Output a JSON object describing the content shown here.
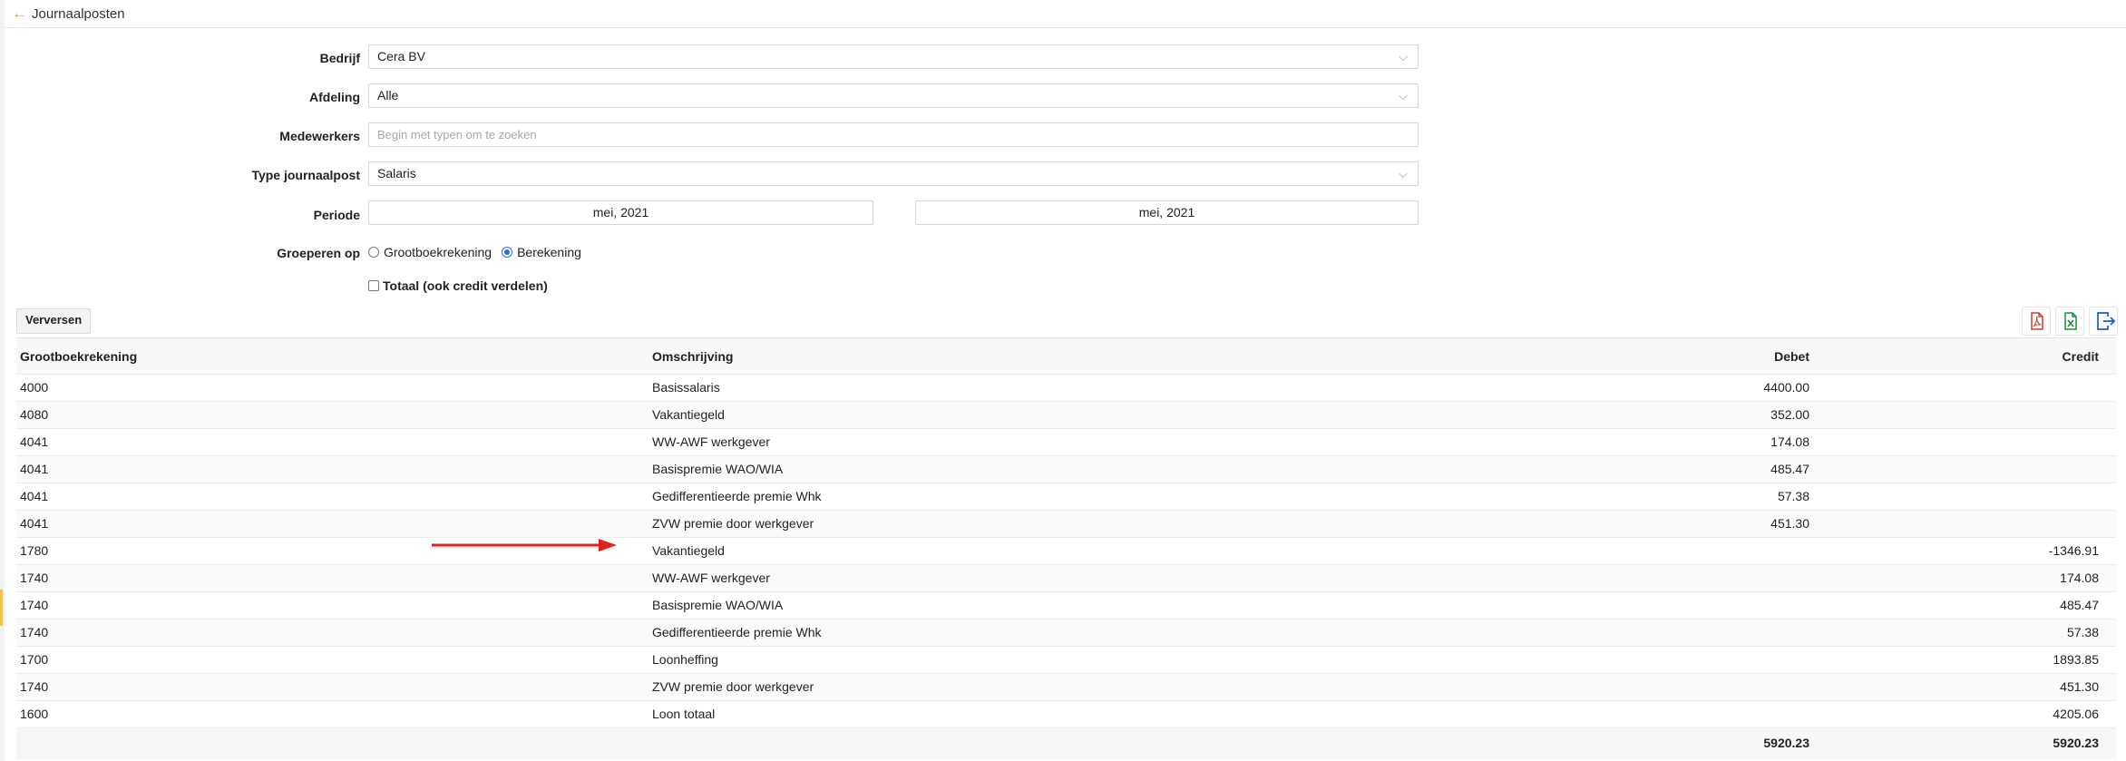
{
  "header": {
    "title": "Journaalposten"
  },
  "form": {
    "company": {
      "label": "Bedrijf",
      "value": "Cera BV"
    },
    "department": {
      "label": "Afdeling",
      "value": "Alle"
    },
    "employees": {
      "label": "Medewerkers",
      "placeholder": "Begin met typen om te zoeken"
    },
    "entry_type": {
      "label": "Type journaalpost",
      "value": "Salaris"
    },
    "period": {
      "label": "Periode",
      "from": "mei, 2021",
      "to": "mei, 2021"
    },
    "group_by": {
      "label": "Groeperen op",
      "option_ledger": "Grootboekrekening",
      "option_calc": "Berekening",
      "selected": "Berekening"
    },
    "total_checkbox": {
      "label": "Totaal (ook credit verdelen)",
      "checked": false
    }
  },
  "toolbar": {
    "refresh_label": "Verversen",
    "icons": [
      "pdf-export-icon",
      "excel-export-icon",
      "export-icon"
    ]
  },
  "table": {
    "columns": {
      "account": "Grootboekrekening",
      "description": "Omschrijving",
      "debit": "Debet",
      "credit": "Credit"
    },
    "rows": [
      {
        "account": "4000",
        "description": "Basissalaris",
        "debit": "4400.00",
        "credit": ""
      },
      {
        "account": "4080",
        "description": "Vakantiegeld",
        "debit": "352.00",
        "credit": ""
      },
      {
        "account": "4041",
        "description": "WW-AWF werkgever",
        "debit": "174.08",
        "credit": ""
      },
      {
        "account": "4041",
        "description": "Basispremie WAO/WIA",
        "debit": "485.47",
        "credit": ""
      },
      {
        "account": "4041",
        "description": "Gedifferentieerde premie Whk",
        "debit": "57.38",
        "credit": ""
      },
      {
        "account": "4041",
        "description": "ZVW premie door werkgever",
        "debit": "451.30",
        "credit": ""
      },
      {
        "account": "1780",
        "description": "Vakantiegeld",
        "debit": "",
        "credit": "-1346.91"
      },
      {
        "account": "1740",
        "description": "WW-AWF werkgever",
        "debit": "",
        "credit": "174.08"
      },
      {
        "account": "1740",
        "description": "Basispremie WAO/WIA",
        "debit": "",
        "credit": "485.47"
      },
      {
        "account": "1740",
        "description": "Gedifferentieerde premie Whk",
        "debit": "",
        "credit": "57.38"
      },
      {
        "account": "1700",
        "description": "Loonheffing",
        "debit": "",
        "credit": "1893.85"
      },
      {
        "account": "1740",
        "description": "ZVW premie door werkgever",
        "debit": "",
        "credit": "451.30"
      },
      {
        "account": "1600",
        "description": "Loon totaal",
        "debit": "",
        "credit": "4205.06"
      }
    ],
    "totals": {
      "debit": "5920.23",
      "credit": "5920.23"
    }
  },
  "colors": {
    "accent": "#e39b17",
    "arrow": "#e0231b",
    "radio": "#2b6fd6",
    "pdf": "#d83a2f",
    "excel": "#1f8a3a",
    "export": "#1d5fc4"
  }
}
